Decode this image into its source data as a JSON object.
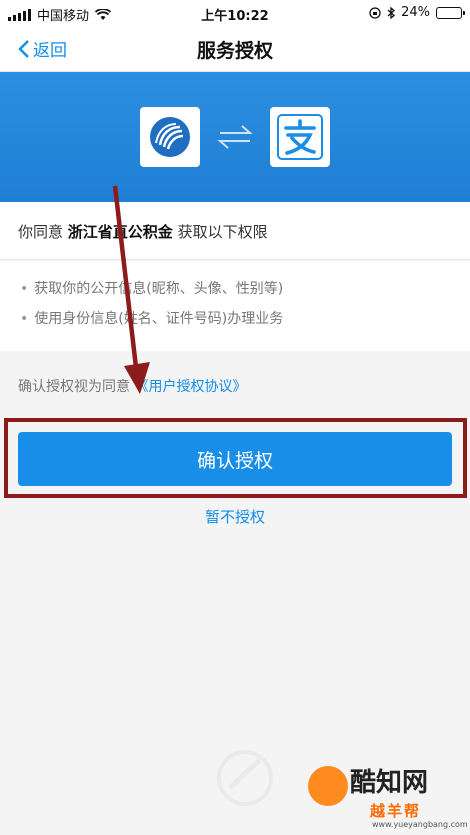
{
  "status_bar": {
    "carrier": "中国移动",
    "time": "上午10:22",
    "battery": "24%",
    "battery_level": 0.24
  },
  "nav": {
    "back_label": "返回",
    "title": "服务授权"
  },
  "banner": {
    "app_icon": "zhejiang-provident-fund-logo",
    "swap_icon": "swap-arrows-icon",
    "alipay_icon_char": "支",
    "colors": {
      "banner": "#1e7fd4",
      "accent": "#108ee9",
      "annotation": "#8c1b1b"
    }
  },
  "consent": {
    "prefix": "你同意 ",
    "org_name": "浙江省直公积金",
    "suffix": " 获取以下权限"
  },
  "permissions": [
    "获取你的公开信息(昵称、头像、性别等)",
    "使用身份信息(姓名、证件号码)办理业务"
  ],
  "agreement": {
    "prefix": "确认授权视为同意",
    "link": "《用户授权协议》"
  },
  "actions": {
    "confirm_label": "确认授权",
    "deny_label": "暂不授权"
  },
  "watermark": {
    "brand": "酷知网",
    "brand2": "越羊帮",
    "url": "www.yueyangbang.com"
  }
}
